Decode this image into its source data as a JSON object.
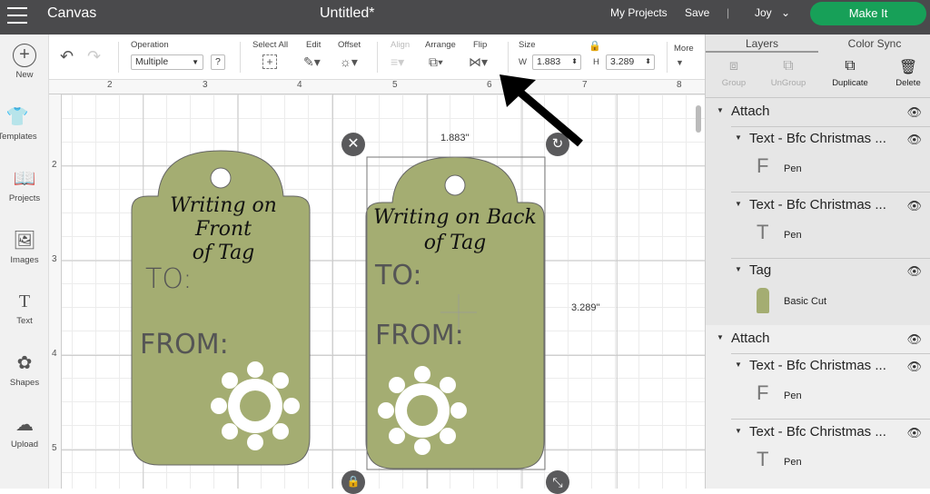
{
  "header": {
    "menu_icon": "hamburger-icon",
    "app": "Canvas",
    "title": "Untitled*",
    "my_projects": "My Projects",
    "save": "Save",
    "divider": "|",
    "user": "Joy",
    "make_it": "Make It",
    "make_it_color": "#17a058"
  },
  "sidebar": [
    {
      "label": "New",
      "icon": "plus-circle-icon"
    },
    {
      "label": "Templates",
      "icon": "shirt-icon"
    },
    {
      "label": "Projects",
      "icon": "book-icon"
    },
    {
      "label": "Images",
      "icon": "image-icon"
    },
    {
      "label": "Text",
      "icon": "text-icon"
    },
    {
      "label": "Shapes",
      "icon": "shapes-icon"
    },
    {
      "label": "Upload",
      "icon": "upload-icon"
    }
  ],
  "toolbar": {
    "operation_label": "Operation",
    "operation_value": "Multiple",
    "help": "?",
    "select_all": "Select All",
    "edit": "Edit",
    "offset": "Offset",
    "align": "Align",
    "arrange": "Arrange",
    "flip": "Flip",
    "size": "Size",
    "w_label": "W",
    "w_value": "1.883",
    "h_label": "H",
    "h_value": "3.289",
    "more": "More"
  },
  "ruler": {
    "h": [
      "2",
      "3",
      "4",
      "5",
      "6",
      "7",
      "8"
    ],
    "v": [
      "2",
      "3",
      "4",
      "5"
    ]
  },
  "canvas": {
    "width_readout": "1.883\"",
    "height_readout": "3.289\"",
    "tag_color": "#a4ad72",
    "left_tag": {
      "title1": "Writing on Front",
      "title2": "of Tag",
      "to": "TO:",
      "from": "FROM:"
    },
    "right_tag": {
      "title1": "Writing on Back",
      "title2": "of Tag",
      "to": "TO:",
      "from": "FROM:"
    }
  },
  "panel": {
    "tabs": [
      "Layers",
      "Color Sync"
    ],
    "actions": {
      "group": "Group",
      "ungroup": "UnGroup",
      "duplicate": "Duplicate",
      "delete": "Delete"
    },
    "layers": [
      {
        "name": "Attach",
        "children": [
          {
            "name": "Text - Bfc Christmas ...",
            "op": "Pen",
            "glyph": "F"
          },
          {
            "name": "Text - Bfc Christmas ...",
            "op": "Pen",
            "glyph": "T"
          },
          {
            "name": "Tag",
            "op": "Basic Cut"
          }
        ]
      },
      {
        "name": "Attach",
        "children": [
          {
            "name": "Text - Bfc Christmas ...",
            "op": "Pen",
            "glyph": "F"
          },
          {
            "name": "Text - Bfc Christmas ...",
            "op": "Pen",
            "glyph": "T"
          }
        ]
      }
    ]
  }
}
